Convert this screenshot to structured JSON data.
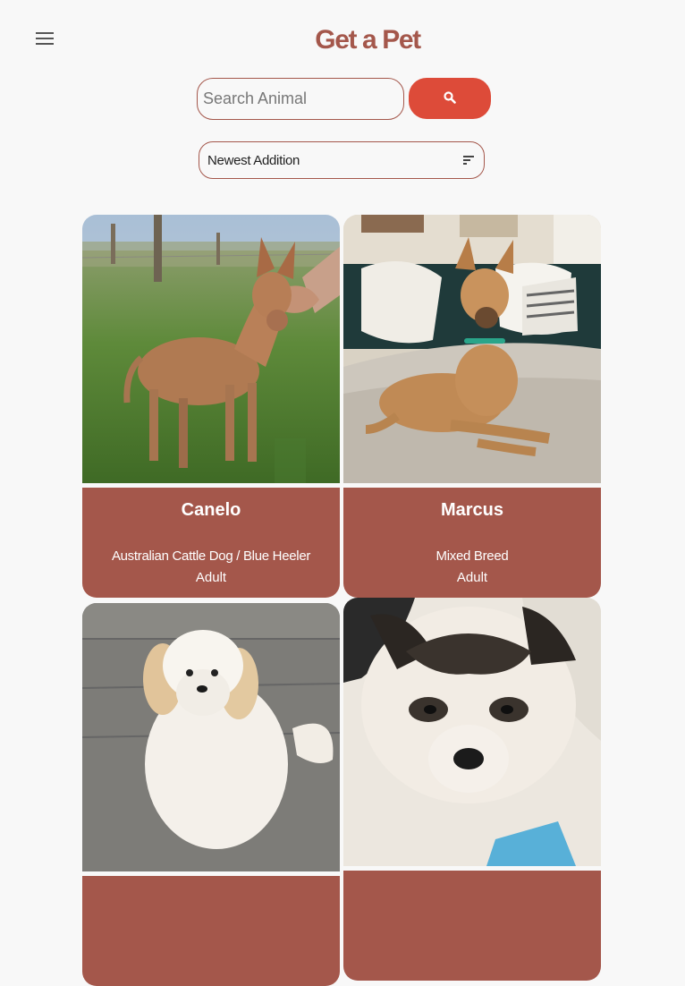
{
  "header": {
    "title": "Get a Pet",
    "menu_icon": "hamburger-menu-icon"
  },
  "search": {
    "placeholder": "Search Animal",
    "value": "",
    "button_icon": "search-icon"
  },
  "sort": {
    "selected": "Newest Addition",
    "icon": "sort-icon"
  },
  "pets": [
    {
      "name": "Canelo",
      "breed": "Australian Cattle Dog / Blue Heeler",
      "age": "Adult"
    },
    {
      "name": "Marcus",
      "breed": "Mixed Breed",
      "age": "Adult"
    },
    {
      "name": "",
      "breed": "",
      "age": ""
    },
    {
      "name": "",
      "breed": "",
      "age": ""
    }
  ],
  "colors": {
    "brand": "#a4574b",
    "accent": "#dd4b39",
    "background": "#f8f8f8"
  }
}
